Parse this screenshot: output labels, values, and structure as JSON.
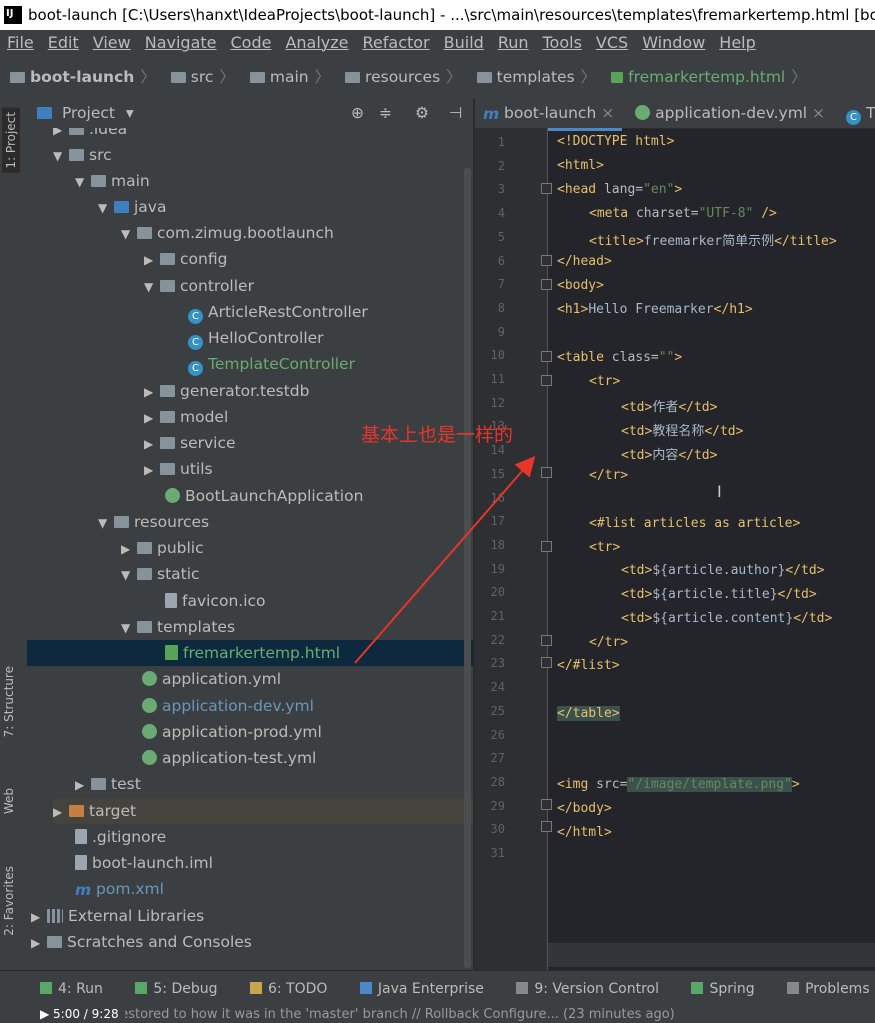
{
  "window_title": "boot-launch [C:\\Users\\hanxt\\IdeaProjects\\boot-launch] - ...\\src\\main\\resources\\templates\\fremarkertemp.html [boot",
  "menu": [
    "File",
    "Edit",
    "View",
    "Navigate",
    "Code",
    "Analyze",
    "Refactor",
    "Build",
    "Run",
    "Tools",
    "VCS",
    "Window",
    "Help"
  ],
  "breadcrumbs": [
    "boot-launch",
    "src",
    "main",
    "resources",
    "templates",
    "fremarkertemp.html"
  ],
  "side_tabs": {
    "project": "1: Project",
    "structure": "7: Structure",
    "web": "Web",
    "favorites": "2: Favorites"
  },
  "project_panel": {
    "title": "Project",
    "dropdown": "▾"
  },
  "tree": [
    {
      "label": ".idea",
      "arrow": "▶"
    },
    {
      "label": "src",
      "arrow": "▼"
    },
    {
      "label": "main",
      "arrow": "▼"
    },
    {
      "label": "java",
      "arrow": "▼"
    },
    {
      "label": "com.zimug.bootlaunch",
      "arrow": "▼"
    },
    {
      "label": "config",
      "arrow": "▶"
    },
    {
      "label": "controller",
      "arrow": "▼"
    },
    {
      "label": "ArticleRestController",
      "arrow": ""
    },
    {
      "label": "HelloController",
      "arrow": ""
    },
    {
      "label": "TemplateController",
      "arrow": ""
    },
    {
      "label": "generator.testdb",
      "arrow": "▶"
    },
    {
      "label": "model",
      "arrow": "▶"
    },
    {
      "label": "service",
      "arrow": "▶"
    },
    {
      "label": "utils",
      "arrow": "▶"
    },
    {
      "label": "BootLaunchApplication",
      "arrow": ""
    },
    {
      "label": "resources",
      "arrow": "▼"
    },
    {
      "label": "public",
      "arrow": "▶"
    },
    {
      "label": "static",
      "arrow": "▼"
    },
    {
      "label": "favicon.ico",
      "arrow": ""
    },
    {
      "label": "templates",
      "arrow": "▼"
    },
    {
      "label": "fremarkertemp.html",
      "arrow": ""
    },
    {
      "label": "application.yml",
      "arrow": ""
    },
    {
      "label": "application-dev.yml",
      "arrow": ""
    },
    {
      "label": "application-prod.yml",
      "arrow": ""
    },
    {
      "label": "application-test.yml",
      "arrow": ""
    },
    {
      "label": "test",
      "arrow": "▶"
    },
    {
      "label": "target",
      "arrow": "▶"
    },
    {
      "label": ".gitignore",
      "arrow": ""
    },
    {
      "label": "boot-launch.iml",
      "arrow": ""
    },
    {
      "label": "pom.xml",
      "arrow": ""
    },
    {
      "label": "External Libraries",
      "arrow": "▶"
    },
    {
      "label": "Scratches and Consoles",
      "arrow": "▶"
    }
  ],
  "editor_tabs": [
    {
      "label": "boot-launch",
      "close": "×"
    },
    {
      "label": "application-dev.yml",
      "close": "×"
    },
    {
      "label": "T"
    }
  ],
  "line_numbers": [
    "1",
    "2",
    "3",
    "4",
    "5",
    "6",
    "7",
    "8",
    "9",
    "10",
    "11",
    "12",
    "13",
    "14",
    "15",
    "16",
    "17",
    "18",
    "19",
    "20",
    "21",
    "22",
    "23",
    "24",
    "25",
    "26",
    "27",
    "28",
    "29",
    "30",
    "31"
  ],
  "code": {
    "l1_doctype": "<!DOCTYPE html>",
    "l2": "<html>",
    "l3_tag": "<head ",
    "l3_attr": "lang=",
    "l3_val": "\"en\"",
    "l3_end": ">",
    "l4_tag": "<meta ",
    "l4_attr": "charset=",
    "l4_val": "\"UTF-8\"",
    "l4_end": " />",
    "l5_open": "<title>",
    "l5_text": "freemarker简单示例",
    "l5_close": "</title>",
    "l6": "</head>",
    "l7": "<body>",
    "l8_open": "<h1>",
    "l8_text": "Hello Freemarker",
    "l8_close": "</h1>",
    "l10_tag": "<table ",
    "l10_attr": "class=",
    "l10_val": "\"\"",
    "l10_end": ">",
    "l11": "<tr>",
    "l12_open": "<td>",
    "l12_text": "作者",
    "l12_close": "</td>",
    "l13_open": "<td>",
    "l13_text": "教程名称",
    "l13_close": "</td>",
    "l14_open": "<td>",
    "l14_text": "内容",
    "l14_close": "</td>",
    "l15": "</tr>",
    "l17": "<#list articles as article>",
    "l18": "<tr>",
    "l19_open": "<td>",
    "l19_text": "${article.author}",
    "l19_close": "</td>",
    "l20_open": "<td>",
    "l20_text": "${article.title}",
    "l20_close": "</td>",
    "l21_open": "<td>",
    "l21_text": "${article.content}",
    "l21_close": "</td>",
    "l22": "</tr>",
    "l23": "</#list>",
    "l25": "</table>",
    "l28_tag": "<img ",
    "l28_attr": "src=",
    "l28_val": "\"/image/template.png\"",
    "l28_end": ">",
    "l29": "</body>",
    "l30": "</html>"
  },
  "annotation": "基本上也是一样的",
  "bottom_tools": [
    {
      "label": "4: Run"
    },
    {
      "label": "5: Debug"
    },
    {
      "label": "6: TODO"
    },
    {
      "label": "Java Enterprise"
    },
    {
      "label": "9: Version Control"
    },
    {
      "label": "Spring"
    },
    {
      "label": "Problems"
    }
  ],
  "status_text": "Workspace restored to how it was in the 'master' branch // Rollback Configure... (23 minutes ago)",
  "player_time": "5:00 / 9:28",
  "colors": {
    "accent": "#4a88c7",
    "annotation": "#e8352b",
    "selection": "#0d293e",
    "tag": "#e8bf6a",
    "string": "#6a8759"
  }
}
